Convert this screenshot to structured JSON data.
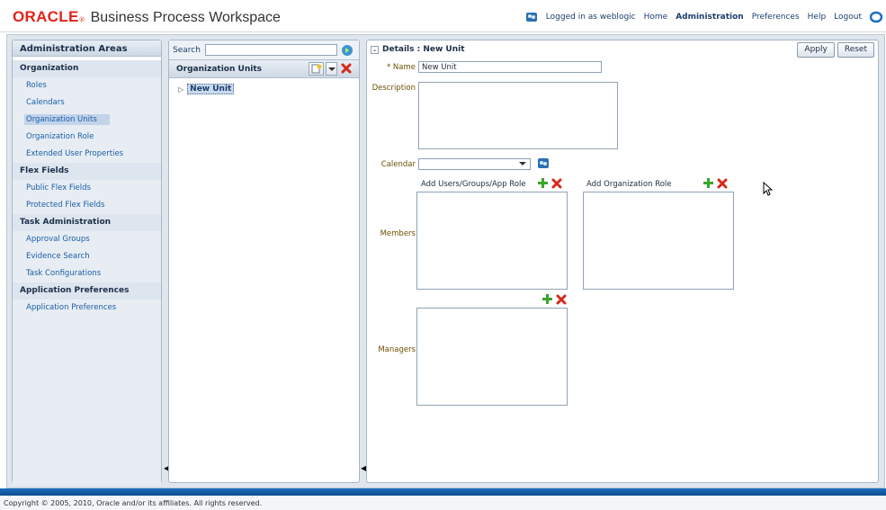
{
  "header": {
    "brand": "ORACLE",
    "brand_reg": "®",
    "product": "Business Process Workspace",
    "logged_in": "Logged in as weblogic",
    "links": [
      "Home",
      "Administration",
      "Preferences",
      "Help",
      "Logout"
    ],
    "active_link": "Administration"
  },
  "left": {
    "title": "Administration Areas",
    "categories": [
      {
        "label": "Organization",
        "items": [
          "Roles",
          "Calendars",
          "Organization Units",
          "Organization Role",
          "Extended User Properties"
        ]
      },
      {
        "label": "Flex Fields",
        "items": [
          "Public Flex Fields",
          "Protected Flex Fields"
        ]
      },
      {
        "label": "Task Administration",
        "items": [
          "Approval Groups",
          "Evidence Search",
          "Task Configurations"
        ]
      },
      {
        "label": "Application Preferences",
        "items": [
          "Application Preferences"
        ]
      }
    ],
    "selected_item": "Organization Units"
  },
  "middle": {
    "search_label": "Search",
    "search_value": "",
    "ou_title": "Organization Units",
    "tree_node": "New Unit"
  },
  "details": {
    "title": "Details : New Unit",
    "apply": "Apply",
    "reset": "Reset",
    "name_label": "* Name",
    "name_value": "New Unit",
    "description_label": "Description",
    "calendar_label": "Calendar",
    "calendar_value": "",
    "members_label": "Members",
    "managers_label": "Managers",
    "add_users_label": "Add Users/Groups/App Role",
    "add_org_role_label": "Add Organization Role"
  },
  "footer": {
    "copyright": "Copyright © 2005, 2010, Oracle and/or its affiliates. All rights reserved."
  }
}
